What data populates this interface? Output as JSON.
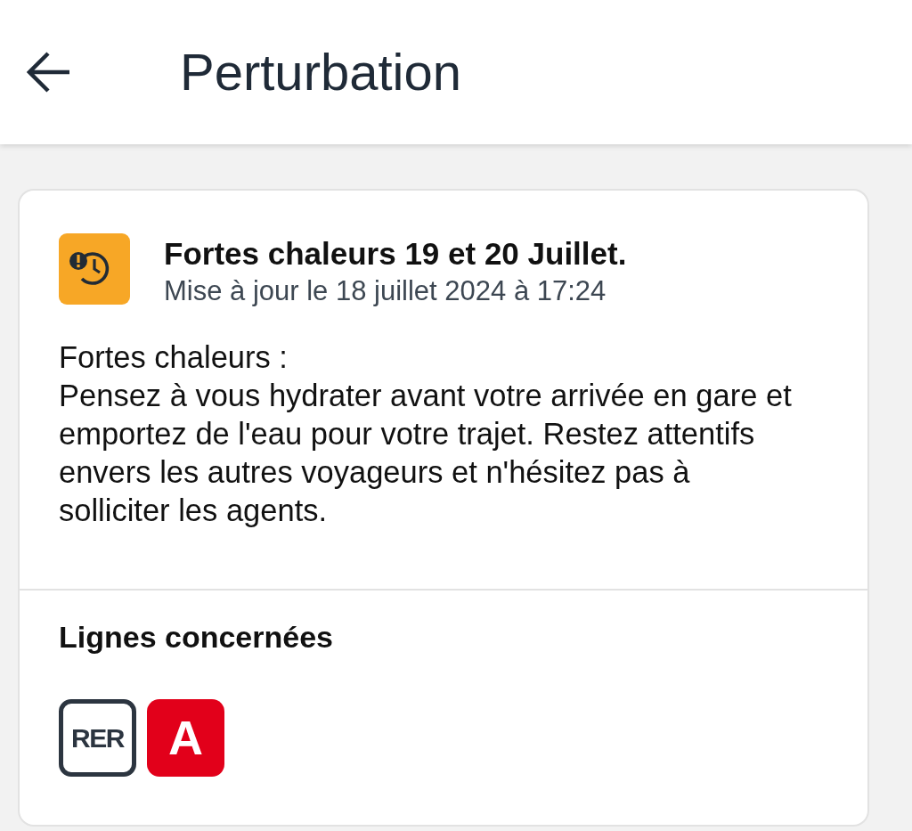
{
  "header": {
    "title": "Perturbation"
  },
  "disruption": {
    "title": "Fortes chaleurs 19 et 20 Juillet.",
    "updated": "Mise à jour le 18 juillet 2024 à 17:24",
    "message": "Fortes chaleurs :\nPensez à vous hydrater avant votre arrivée en gare et emportez de l'eau pour votre trajet. Restez attentifs envers les autres voyageurs et n'hésitez pas à solliciter les agents."
  },
  "affected_lines": {
    "heading": "Lignes concernées",
    "lines": [
      {
        "kind": "mode",
        "label": "RER"
      },
      {
        "kind": "line",
        "label": "A",
        "color": "#e2001a"
      }
    ]
  }
}
